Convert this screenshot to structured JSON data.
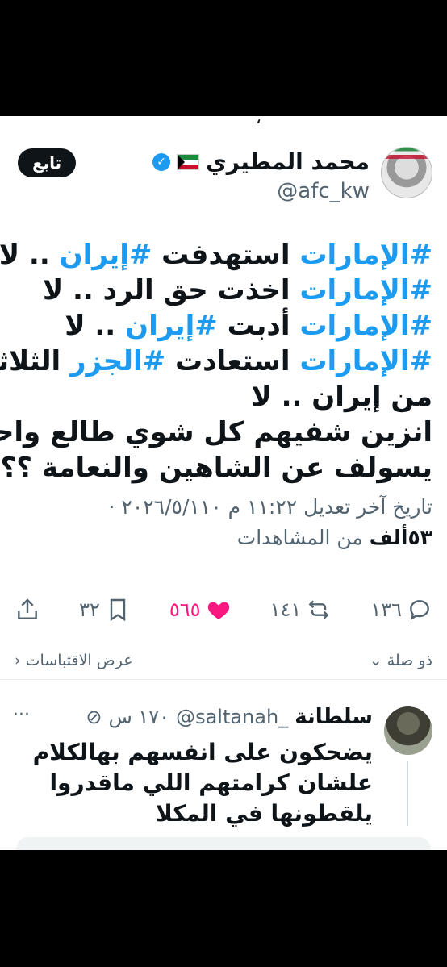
{
  "header": {
    "cutoff_text": "،",
    "name": "محمد المطيري",
    "handle": "@afc_kw",
    "follow_label": "تابع"
  },
  "tweet": {
    "lines": [
      [
        {
          "t": "#الإمارات",
          "h": true
        },
        {
          "t": " استهدفت ",
          "h": false
        },
        {
          "t": "#إيران",
          "h": true
        },
        {
          "t": " .. لا",
          "h": false
        }
      ],
      [
        {
          "t": "#الإمارات",
          "h": true
        },
        {
          "t": " اخذت حق الرد .. لا",
          "h": false
        }
      ],
      [
        {
          "t": "#الإمارات",
          "h": true
        },
        {
          "t": " أدبت ",
          "h": false
        },
        {
          "t": "#إيران",
          "h": true
        },
        {
          "t": " .. لا",
          "h": false
        }
      ],
      [
        {
          "t": "#الإمارات",
          "h": true
        },
        {
          "t": " استعادت ",
          "h": false
        },
        {
          "t": "#الجزر",
          "h": true
        },
        {
          "t": " الثلاثة",
          "h": false
        }
      ],
      [
        {
          "t": "من إيران .. لا",
          "h": false
        }
      ],
      [
        {
          "t": "انزين شفيهم كل شوي طالع واحد",
          "h": false
        }
      ],
      [
        {
          "t": "يسولف عن الشاهين والنعامة ؟؟",
          "h": false
        }
      ]
    ],
    "meta": "تاريخ آخر تعديل ١١:٢٢ م ٢٠٢٦/٥/١١٠ ·",
    "views_count": "٥٣ألف",
    "views_label": " من المشاهدات"
  },
  "actions": {
    "replies": "١٣٦",
    "reposts": "١٤١",
    "likes": "٥٦٥",
    "bookmarks": "٣٢"
  },
  "quotes": {
    "relevant_label": "ذو صلة",
    "view_quotes_label": "عرض الاقتباسات"
  },
  "reply": {
    "name": "سلطانة",
    "handle": "_saltanah@",
    "time": "١٧٠ س",
    "more": "···",
    "lines": [
      "يضحكون على انفسهم بهالكلام",
      "علشان كرامتهم اللي ماقدروا",
      "يلقطونها في المكلا"
    ]
  },
  "colors": {
    "hashtag": "#1d9bf0",
    "like": "#f91880",
    "verified": "#1d9bf0"
  }
}
